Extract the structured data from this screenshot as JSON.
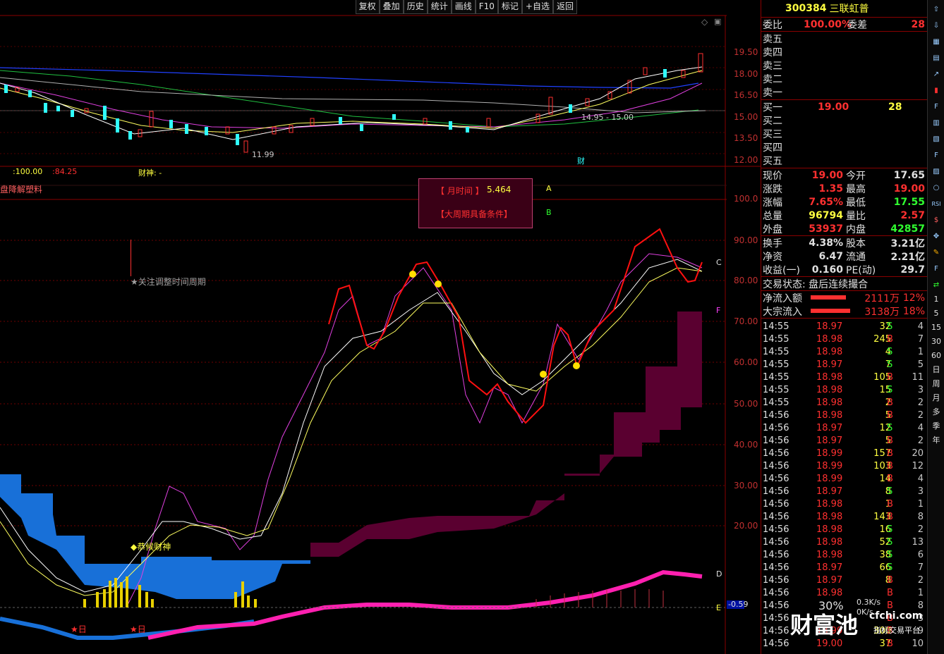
{
  "toolbar": {
    "buttons": [
      "复权",
      "叠加",
      "历史",
      "统计",
      "画线",
      "F10",
      "标记",
      "+自选",
      "返回"
    ]
  },
  "price_axis": [
    "19.50",
    "18.00",
    "16.50",
    "15.00",
    "13.50",
    "12.00"
  ],
  "indicator_axis": [
    "100.0",
    "90.00",
    "80.00",
    "70.00",
    "60.00",
    "50.00",
    "40.00",
    "30.00",
    "20.00"
  ],
  "chart_labels": {
    "low_marker": "11.99",
    "range_marker": "14.95 - 15.00",
    "cai_marker": "财",
    "info_line_1": ":100.00",
    "info_line_2": ":84.25",
    "info_line_3": "财神: -",
    "indicator_name": "盘降解塑料",
    "focus_label": "★关注调整时间周期",
    "gongxi_label": "◆恭候财神",
    "star_day_1": "★日",
    "star_day_2": "★日",
    "line_a": "A",
    "line_b": "B",
    "line_c": "C",
    "line_d": "D",
    "line_e": "E",
    "line_f": "F",
    "neg_value": "-0.59"
  },
  "popup": {
    "title": "【 月时间 】",
    "value": "5.464",
    "condition": "【大周期具备条件】"
  },
  "quote": {
    "code": "300384",
    "name": "三联虹普",
    "weibi_label": "委比",
    "weibi": "100.00%",
    "weicha_label": "委差",
    "weicha": "28",
    "sell": [
      "卖五",
      "卖四",
      "卖三",
      "卖二",
      "卖一"
    ],
    "buy": [
      {
        "label": "买一",
        "price": "19.00",
        "vol": "28"
      },
      {
        "label": "买二",
        "price": "",
        "vol": ""
      },
      {
        "label": "买三",
        "price": "",
        "vol": ""
      },
      {
        "label": "买四",
        "price": "",
        "vol": ""
      },
      {
        "label": "买五",
        "price": "",
        "vol": ""
      }
    ],
    "stats": [
      {
        "l1": "现价",
        "v1": "19.00",
        "c1": "#ff3030",
        "l2": "今开",
        "v2": "17.65",
        "c2": "#e0e0e0"
      },
      {
        "l1": "涨跌",
        "v1": "1.35",
        "c1": "#ff3030",
        "l2": "最高",
        "v2": "19.00",
        "c2": "#ff3030"
      },
      {
        "l1": "涨幅",
        "v1": "7.65%",
        "c1": "#ff3030",
        "l2": "最低",
        "v2": "17.55",
        "c2": "#30ff30"
      },
      {
        "l1": "总量",
        "v1": "96794",
        "c1": "#ffff40",
        "l2": "量比",
        "v2": "2.57",
        "c2": "#ff3030"
      },
      {
        "l1": "外盘",
        "v1": "53937",
        "c1": "#ff3030",
        "l2": "内盘",
        "v2": "42857",
        "c2": "#30ff30"
      },
      {
        "l1": "换手",
        "v1": "4.38%",
        "c1": "#e0e0e0",
        "l2": "股本",
        "v2": "3.21亿",
        "c2": "#e0e0e0"
      },
      {
        "l1": "净资",
        "v1": "6.47",
        "c1": "#e0e0e0",
        "l2": "流通",
        "v2": "2.21亿",
        "c2": "#e0e0e0"
      },
      {
        "l1": "收益(一)",
        "v1": "0.160",
        "c1": "#e0e0e0",
        "l2": "PE(动)",
        "v2": "29.7",
        "c2": "#e0e0e0"
      }
    ],
    "trade_status": "交易状态: 盘后连续撮合",
    "net_inflow_label": "净流入额",
    "net_inflow": "2111万",
    "net_inflow_pct": "12%",
    "block_inflow_label": "大宗流入",
    "block_inflow": "3138万",
    "block_inflow_pct": "18%"
  },
  "trades": [
    {
      "t": "14:55",
      "p": "18.97",
      "v": "32",
      "s": "S",
      "n": "4"
    },
    {
      "t": "14:55",
      "p": "18.98",
      "v": "245",
      "s": "B",
      "n": "7"
    },
    {
      "t": "14:55",
      "p": "18.98",
      "v": "4",
      "s": "S",
      "n": "1"
    },
    {
      "t": "14:55",
      "p": "18.97",
      "v": "7",
      "s": "S",
      "n": "5"
    },
    {
      "t": "14:55",
      "p": "18.98",
      "v": "105",
      "s": "B",
      "n": "11"
    },
    {
      "t": "14:55",
      "p": "18.98",
      "v": "15",
      "s": "S",
      "n": "3"
    },
    {
      "t": "14:55",
      "p": "18.98",
      "v": "2",
      "s": "B",
      "n": "2"
    },
    {
      "t": "14:56",
      "p": "18.98",
      "v": "5",
      "s": "B",
      "n": "2"
    },
    {
      "t": "14:56",
      "p": "18.97",
      "v": "12",
      "s": "S",
      "n": "4"
    },
    {
      "t": "14:56",
      "p": "18.97",
      "v": "5",
      "s": "B",
      "n": "2"
    },
    {
      "t": "14:56",
      "p": "18.99",
      "v": "157",
      "s": "B",
      "n": "20"
    },
    {
      "t": "14:56",
      "p": "18.99",
      "v": "103",
      "s": "B",
      "n": "12"
    },
    {
      "t": "14:56",
      "p": "18.99",
      "v": "14",
      "s": "B",
      "n": "4"
    },
    {
      "t": "14:56",
      "p": "18.97",
      "v": "8",
      "s": "S",
      "n": "3"
    },
    {
      "t": "14:56",
      "p": "18.98",
      "v": "1",
      "s": "B",
      "n": "1"
    },
    {
      "t": "14:56",
      "p": "18.98",
      "v": "143",
      "s": "B",
      "n": "8"
    },
    {
      "t": "14:56",
      "p": "18.98",
      "v": "16",
      "s": "S",
      "n": "2"
    },
    {
      "t": "14:56",
      "p": "18.98",
      "v": "52",
      "s": "S",
      "n": "13"
    },
    {
      "t": "14:56",
      "p": "18.98",
      "v": "38",
      "s": "S",
      "n": "6"
    },
    {
      "t": "14:56",
      "p": "18.97",
      "v": "66",
      "s": "S",
      "n": "7"
    },
    {
      "t": "14:56",
      "p": "18.97",
      "v": "8",
      "s": "B",
      "n": "2"
    },
    {
      "t": "14:56",
      "p": "18.98",
      "v": "",
      "s": "B",
      "n": "1"
    },
    {
      "t": "14:56",
      "p": "",
      "v": "",
      "s": "B",
      "n": "8"
    },
    {
      "t": "14:56",
      "p": "",
      "v": "",
      "s": "B",
      "n": "3"
    },
    {
      "t": "14:56",
      "p": "18.99",
      "v": "300",
      "s": "B",
      "n": "9"
    },
    {
      "t": "14:56",
      "p": "19.00",
      "v": "37",
      "s": "B",
      "n": "10"
    }
  ],
  "iconbar": [
    "1",
    "5",
    "15",
    "30",
    "60",
    "日",
    "周",
    "月",
    "多",
    "季",
    "年"
  ],
  "watermark": {
    "brand": "财富池",
    "site": "cfchi.com",
    "tag": "指标交易平台",
    "speed": "0.3K/s",
    "speed2": "0K/s",
    "pct": "30%"
  },
  "colors": {
    "up": "#ff3030",
    "down": "#30ffff",
    "grid": "#8a0000",
    "buy_text": "#ff3030",
    "sell_text": "#30ff30"
  }
}
